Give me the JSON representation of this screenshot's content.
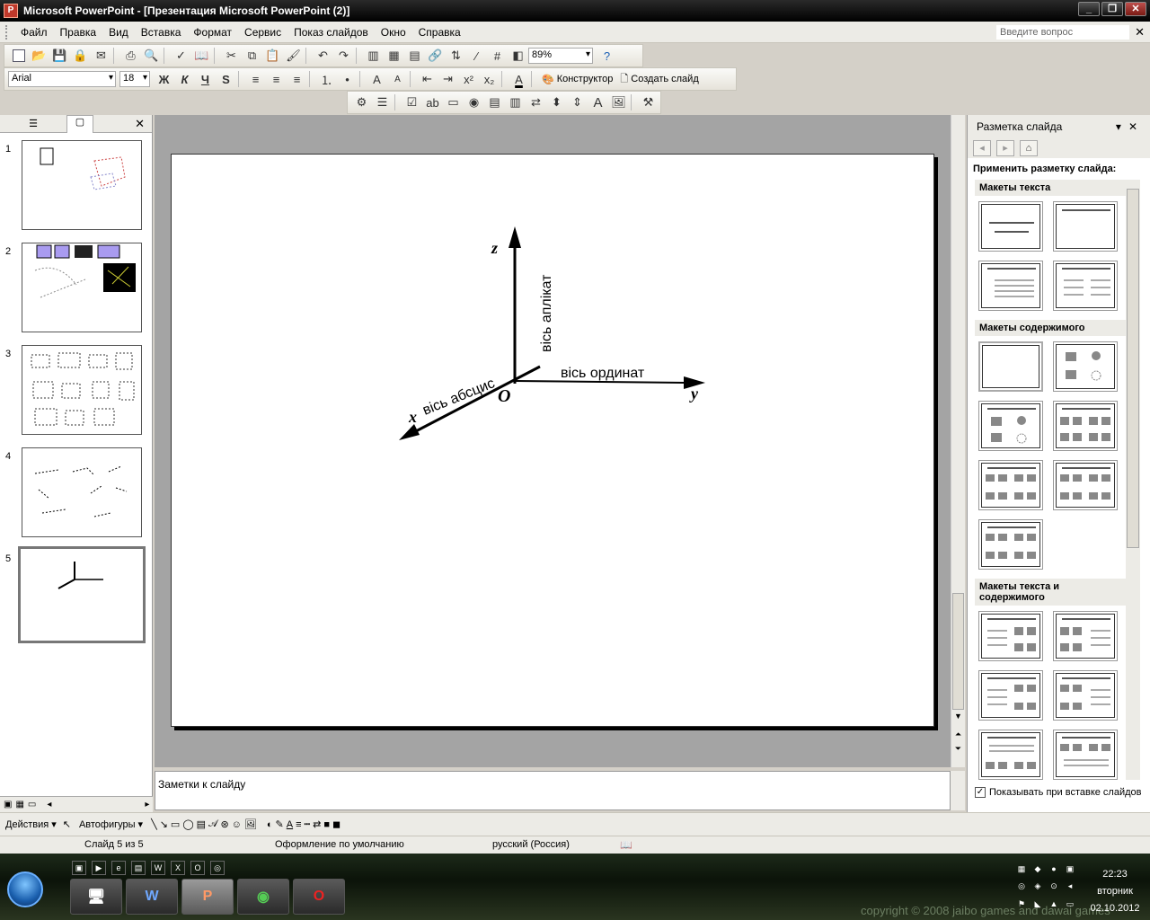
{
  "window": {
    "title": "Microsoft PowerPoint - [Презентация Microsoft PowerPoint (2)]",
    "buttons": [
      "_",
      "❐",
      "✕"
    ]
  },
  "menu": {
    "items": [
      "Файл",
      "Правка",
      "Вид",
      "Вставка",
      "Формат",
      "Сервис",
      "Показ слайдов",
      "Окно",
      "Справка"
    ],
    "ask_placeholder": "Введите вопрос",
    "close": "✕"
  },
  "toolbar1": {
    "zoom": "89%"
  },
  "toolbar2": {
    "font": "Arial",
    "size": "18",
    "bold": "Ж",
    "italic": "К",
    "underline": "Ч",
    "shadow": "S",
    "design_label": "Конструктор",
    "new_slide_label": "Создать слайд"
  },
  "left_panel": {
    "slide_numbers": [
      "1",
      "2",
      "3",
      "4",
      "5"
    ],
    "close": "✕"
  },
  "slide": {
    "axis_z": "z",
    "axis_y": "y",
    "axis_x": "x",
    "origin": "O",
    "label_z": "вісь аплікат",
    "label_y": "вісь ординат",
    "label_x": "вісь абсцис"
  },
  "notes": {
    "placeholder": "Заметки к слайду"
  },
  "taskpane": {
    "title": "Разметка слайда",
    "apply_label": "Применить разметку слайда:",
    "section_text": "Макеты текста",
    "section_content": "Макеты содержимого",
    "section_text_content": "Макеты текста и содержимого",
    "show_on_insert": "Показывать при вставке слайдов",
    "show_checked": "✓"
  },
  "drawing_toolbar": {
    "actions": "Действия",
    "autoshapes": "Автофигуры"
  },
  "status": {
    "slide": "Слайд 5 из 5",
    "design": "Оформление по умолчанию",
    "language": "русский (Россия)"
  },
  "taskbar": {
    "time": "22:23",
    "day": "вторник",
    "date": "02.10.2012",
    "watermark": "copyright © 2008 jaibo games and dawai games"
  }
}
